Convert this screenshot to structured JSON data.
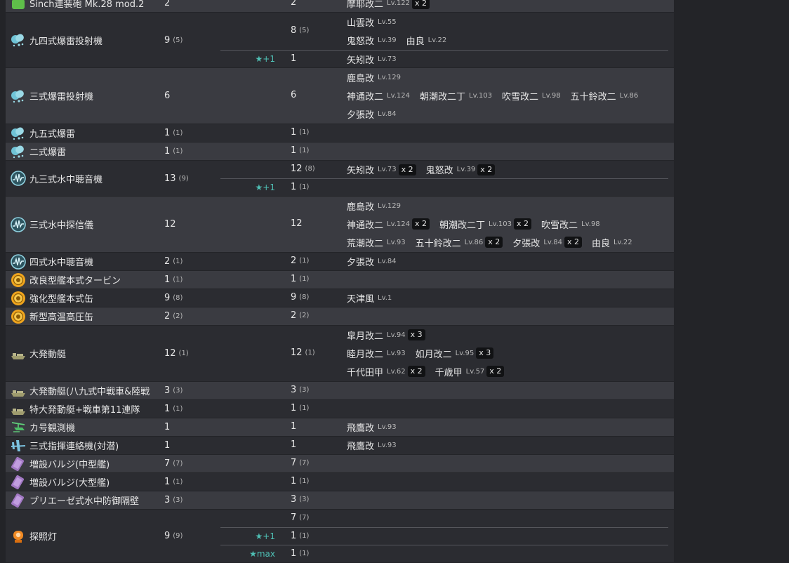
{
  "rows": [
    {
      "name": "Sinch連装砲 Mk.28 mod.2",
      "icon": "green-gun-icon",
      "total": "2",
      "total_sub": "",
      "groups": [
        {
          "improve": "",
          "count": "2",
          "count_sub": "",
          "lines": [
            [
              {
                "name": "摩耶改二",
                "lv": "Lv.122",
                "mult": "x 2"
              }
            ]
          ]
        }
      ]
    },
    {
      "name": "九四式爆雷投射機",
      "icon": "depth-charge-icon",
      "total": "9",
      "total_sub": "(5)",
      "groups": [
        {
          "improve": "",
          "count": "8",
          "count_sub": "(5)",
          "lines": [
            [
              {
                "name": "山雲改",
                "lv": "Lv.55",
                "mult": ""
              }
            ],
            [
              {
                "name": "鬼怒改",
                "lv": "Lv.39",
                "mult": ""
              },
              {
                "name": "由良",
                "lv": "Lv.22",
                "mult": ""
              }
            ]
          ]
        },
        {
          "improve": "★+1",
          "count": "1",
          "count_sub": "",
          "lines": [
            [
              {
                "name": "矢矧改",
                "lv": "Lv.73",
                "mult": ""
              }
            ]
          ]
        }
      ]
    },
    {
      "name": "三式爆雷投射機",
      "icon": "depth-charge-icon",
      "total": "6",
      "total_sub": "",
      "groups": [
        {
          "improve": "",
          "count": "6",
          "count_sub": "",
          "lines": [
            [
              {
                "name": "鹿島改",
                "lv": "Lv.129",
                "mult": ""
              }
            ],
            [
              {
                "name": "神通改二",
                "lv": "Lv.124",
                "mult": ""
              },
              {
                "name": "朝潮改二丁",
                "lv": "Lv.103",
                "mult": ""
              },
              {
                "name": "吹雪改二",
                "lv": "Lv.98",
                "mult": ""
              },
              {
                "name": "五十鈴改二",
                "lv": "Lv.86",
                "mult": ""
              }
            ],
            [
              {
                "name": "夕張改",
                "lv": "Lv.84",
                "mult": ""
              }
            ]
          ]
        }
      ]
    },
    {
      "name": "九五式爆雷",
      "icon": "depth-charge-icon",
      "total": "1",
      "total_sub": "(1)",
      "groups": [
        {
          "improve": "",
          "count": "1",
          "count_sub": "(1)",
          "lines": [
            []
          ]
        }
      ]
    },
    {
      "name": "二式爆雷",
      "icon": "depth-charge-icon",
      "total": "1",
      "total_sub": "(1)",
      "groups": [
        {
          "improve": "",
          "count": "1",
          "count_sub": "(1)",
          "lines": [
            []
          ]
        }
      ]
    },
    {
      "name": "九三式水中聴音機",
      "icon": "sonar-icon",
      "total": "13",
      "total_sub": "(9)",
      "groups": [
        {
          "improve": "",
          "count": "12",
          "count_sub": "(8)",
          "lines": [
            [
              {
                "name": "矢矧改",
                "lv": "Lv.73",
                "mult": "x 2"
              },
              {
                "name": "鬼怒改",
                "lv": "Lv.39",
                "mult": "x 2"
              }
            ]
          ]
        },
        {
          "improve": "★+1",
          "count": "1",
          "count_sub": "(1)",
          "lines": [
            []
          ]
        }
      ]
    },
    {
      "name": "三式水中探信儀",
      "icon": "sonar-icon",
      "total": "12",
      "total_sub": "",
      "groups": [
        {
          "improve": "",
          "count": "12",
          "count_sub": "",
          "lines": [
            [
              {
                "name": "鹿島改",
                "lv": "Lv.129",
                "mult": ""
              }
            ],
            [
              {
                "name": "神通改二",
                "lv": "Lv.124",
                "mult": "x 2"
              },
              {
                "name": "朝潮改二丁",
                "lv": "Lv.103",
                "mult": "x 2"
              },
              {
                "name": "吹雪改二",
                "lv": "Lv.98",
                "mult": ""
              }
            ],
            [
              {
                "name": "荒潮改二",
                "lv": "Lv.93",
                "mult": ""
              },
              {
                "name": "五十鈴改二",
                "lv": "Lv.86",
                "mult": "x 2"
              },
              {
                "name": "夕張改",
                "lv": "Lv.84",
                "mult": "x 2"
              },
              {
                "name": "由良",
                "lv": "Lv.22",
                "mult": ""
              }
            ]
          ]
        }
      ]
    },
    {
      "name": "四式水中聴音機",
      "icon": "sonar-icon",
      "total": "2",
      "total_sub": "(1)",
      "groups": [
        {
          "improve": "",
          "count": "2",
          "count_sub": "(1)",
          "lines": [
            [
              {
                "name": "夕張改",
                "lv": "Lv.84",
                "mult": ""
              }
            ]
          ]
        }
      ]
    },
    {
      "name": "改良型艦本式タービン",
      "icon": "engine-icon",
      "total": "1",
      "total_sub": "(1)",
      "groups": [
        {
          "improve": "",
          "count": "1",
          "count_sub": "(1)",
          "lines": [
            []
          ]
        }
      ]
    },
    {
      "name": "強化型艦本式缶",
      "icon": "engine-icon",
      "total": "9",
      "total_sub": "(8)",
      "groups": [
        {
          "improve": "",
          "count": "9",
          "count_sub": "(8)",
          "lines": [
            [
              {
                "name": "天津風",
                "lv": "Lv.1",
                "mult": ""
              }
            ]
          ]
        }
      ]
    },
    {
      "name": "新型高温高圧缶",
      "icon": "engine-icon",
      "total": "2",
      "total_sub": "(2)",
      "groups": [
        {
          "improve": "",
          "count": "2",
          "count_sub": "(2)",
          "lines": [
            []
          ]
        }
      ]
    },
    {
      "name": "大発動艇",
      "icon": "landing-craft-icon",
      "total": "12",
      "total_sub": "(1)",
      "groups": [
        {
          "improve": "",
          "count": "12",
          "count_sub": "(1)",
          "lines": [
            [
              {
                "name": "皐月改二",
                "lv": "Lv.94",
                "mult": "x 3"
              }
            ],
            [
              {
                "name": "睦月改二",
                "lv": "Lv.93",
                "mult": ""
              },
              {
                "name": "如月改二",
                "lv": "Lv.95",
                "mult": "x 3"
              }
            ],
            [
              {
                "name": "千代田甲",
                "lv": "Lv.62",
                "mult": "x 2"
              },
              {
                "name": "千歳甲",
                "lv": "Lv.57",
                "mult": "x 2"
              }
            ]
          ]
        }
      ]
    },
    {
      "name": "大発動艇(八九式中戦車&陸戦",
      "icon": "landing-craft-icon",
      "total": "3",
      "total_sub": "(3)",
      "groups": [
        {
          "improve": "",
          "count": "3",
          "count_sub": "(3)",
          "lines": [
            []
          ]
        }
      ]
    },
    {
      "name": "特大発動艇+戦車第11連隊",
      "icon": "landing-craft-icon",
      "total": "1",
      "total_sub": "(1)",
      "groups": [
        {
          "improve": "",
          "count": "1",
          "count_sub": "(1)",
          "lines": [
            []
          ]
        }
      ]
    },
    {
      "name": "カ号観測機",
      "icon": "autogyro-icon",
      "total": "1",
      "total_sub": "",
      "groups": [
        {
          "improve": "",
          "count": "1",
          "count_sub": "",
          "lines": [
            [
              {
                "name": "飛鷹改",
                "lv": "Lv.93",
                "mult": ""
              }
            ]
          ]
        }
      ]
    },
    {
      "name": "三式指揮連絡機(対潜)",
      "icon": "liaison-plane-icon",
      "total": "1",
      "total_sub": "",
      "groups": [
        {
          "improve": "",
          "count": "1",
          "count_sub": "",
          "lines": [
            [
              {
                "name": "飛鷹改",
                "lv": "Lv.93",
                "mult": ""
              }
            ]
          ]
        }
      ]
    },
    {
      "name": "増設バルジ(中型艦)",
      "icon": "bulge-icon",
      "total": "7",
      "total_sub": "(7)",
      "groups": [
        {
          "improve": "",
          "count": "7",
          "count_sub": "(7)",
          "lines": [
            []
          ]
        }
      ]
    },
    {
      "name": "増設バルジ(大型艦)",
      "icon": "bulge-icon",
      "total": "1",
      "total_sub": "(1)",
      "groups": [
        {
          "improve": "",
          "count": "1",
          "count_sub": "(1)",
          "lines": [
            []
          ]
        }
      ]
    },
    {
      "name": "プリエーゼ式水中防御隔壁",
      "icon": "bulge-icon",
      "total": "3",
      "total_sub": "(3)",
      "groups": [
        {
          "improve": "",
          "count": "3",
          "count_sub": "(3)",
          "lines": [
            []
          ]
        }
      ]
    },
    {
      "name": "探照灯",
      "icon": "searchlight-icon",
      "total": "9",
      "total_sub": "(9)",
      "groups": [
        {
          "improve": "",
          "count": "7",
          "count_sub": "(7)",
          "lines": [
            []
          ]
        },
        {
          "improve": "★+1",
          "count": "1",
          "count_sub": "(1)",
          "lines": [
            []
          ]
        },
        {
          "improve": "★max",
          "count": "1",
          "count_sub": "(1)",
          "lines": [
            []
          ]
        }
      ]
    }
  ]
}
